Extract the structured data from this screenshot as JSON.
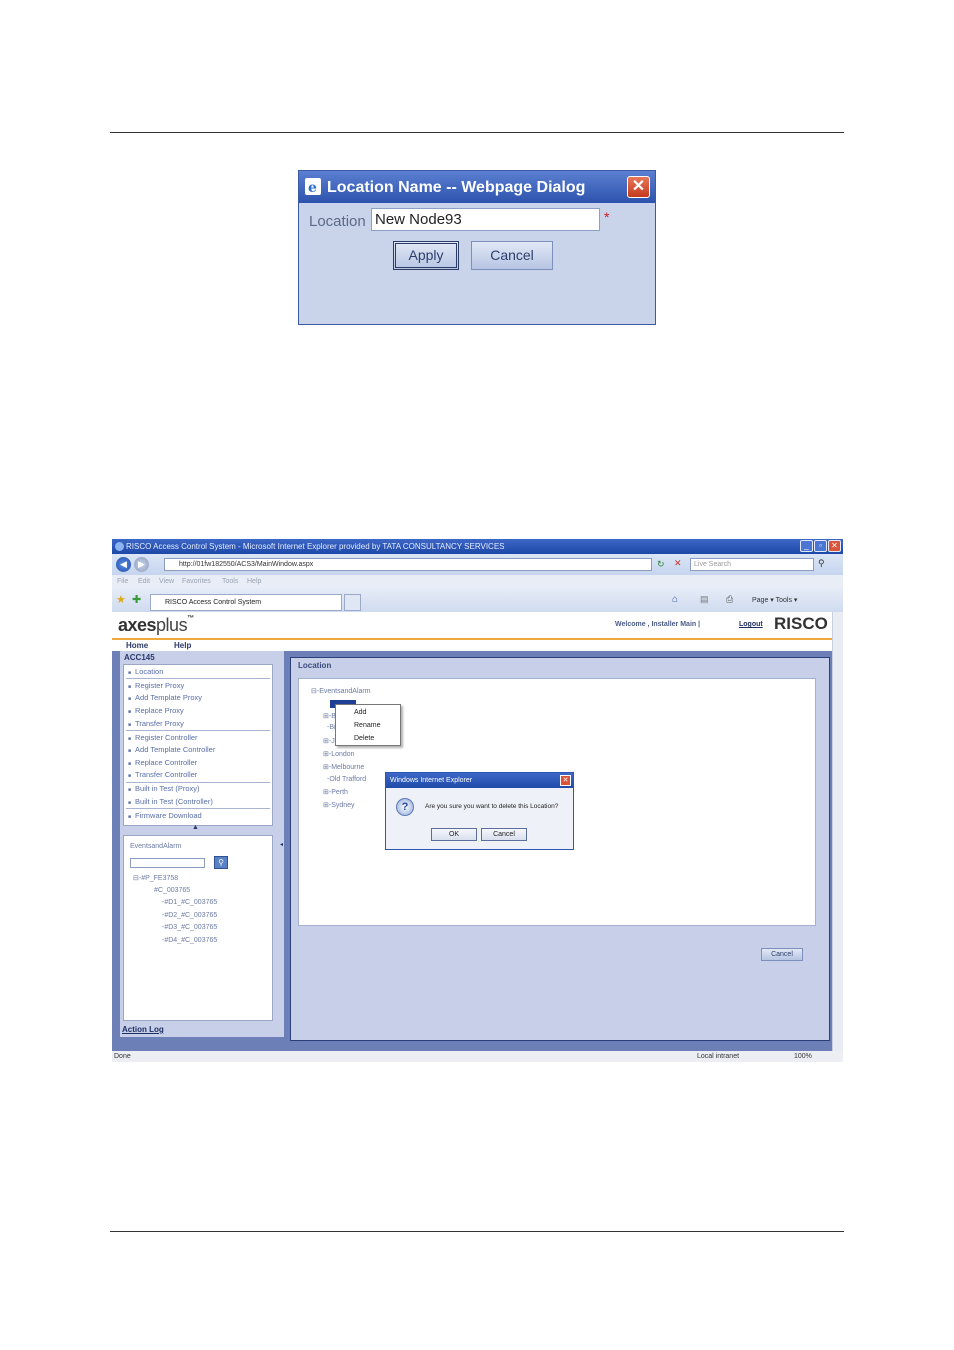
{
  "dialog": {
    "title": "Location Name -- Webpage Dialog",
    "close_glyph": "✕",
    "field_label": "Location",
    "field_value": "New Node93",
    "required_mark": "*",
    "apply_label": "Apply",
    "cancel_label": "Cancel"
  },
  "browser": {
    "window_title": "RISCO Access Control System - Microsoft Internet Explorer provided by TATA CONSULTANCY SERVICES",
    "url": "http://01fw182550/ACS3/MainWindow.aspx",
    "search_placeholder": "Live Search",
    "menus": [
      "File",
      "Edit",
      "View",
      "Favorites",
      "Tools",
      "Help"
    ],
    "tab_title": "RISCO Access Control System",
    "toolbar_text": "Page ▾   Tools ▾",
    "logo": {
      "brand": "axes",
      "plus": "plus",
      "tm": "™"
    },
    "welcome_text": "Welcome ,  Installer Main  |",
    "logout_label": "Logout",
    "risco_logo": "RISCO",
    "app_menu": [
      "Home",
      "Help"
    ],
    "panel_name": "ACC145",
    "left_menu": [
      "Location",
      "Register Proxy",
      "Add Template Proxy",
      "Replace Proxy",
      "Transfer Proxy",
      "Register Controller",
      "Add Template Controller",
      "Replace Controller",
      "Transfer Controller",
      "Built in Test (Proxy)",
      "Built in Test (Controller)",
      "Firmware Download"
    ],
    "tree_root": "EventsandAlarm",
    "tree_nodes": [
      "⊟-#P_FE3758",
      "#C_003765",
      "-#D1_#C_003765",
      "-#D2_#C_003765",
      "-#D3_#C_003765",
      "-#D4_#C_003765"
    ],
    "action_log": "Action Log",
    "section_title": "Location",
    "location_root": "EventsandAlarm",
    "locations": [
      "Br",
      "Bi",
      "Ja",
      "London",
      "Melbourne",
      "Old Trafford",
      "Perth",
      "Sydney"
    ],
    "context_menu": [
      "Add",
      "Rename",
      "Delete"
    ],
    "confirm": {
      "title": "Windows Internet Explorer",
      "message": "Are you sure you want to delete this Location?",
      "ok_label": "OK",
      "cancel_label": "Cancel"
    },
    "cancel_label": "Cancel",
    "status_left": "Done",
    "status_zone": "Local intranet",
    "status_zoom": "100%"
  }
}
